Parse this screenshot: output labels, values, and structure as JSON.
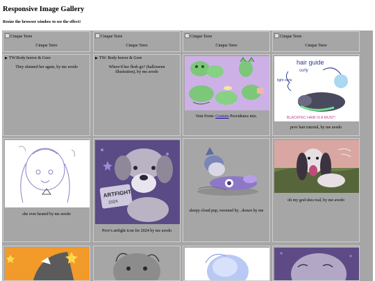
{
  "page": {
    "title": "Responsive Image Gallery",
    "subtitle": "Resize the browser window to see the effect!"
  },
  "gallery": {
    "row1": [
      {
        "alt": "Cinque Terre",
        "caption": "Cinque Terre"
      },
      {
        "alt": "Cinque Terre",
        "caption": "Cinque Terre"
      },
      {
        "alt": "Cinque Terre",
        "caption": "Cinque Terre"
      },
      {
        "alt": "Cinque Terre",
        "caption": "Cinque Terre"
      }
    ],
    "row2": [
      {
        "summary": "TW:Body horror & Gore",
        "caption": "They skinned her again, by me avedo"
      },
      {
        "summary": "TW: Body horror & Gore",
        "caption": "Where'd her flesh go? (halloween illustration), by me avedo"
      },
      {
        "caption_before": "Vent Form: ",
        "link": "Couture",
        "caption_after": " Providence mix."
      },
      {
        "caption": "prov hair tutorial, by me avedo",
        "art_text": [
          "hair guide",
          "curly",
          "tight curls",
          "BLACKPEC HAIR IS A MUST!"
        ]
      }
    ],
    "row3": [
      {
        "caption": "she over heated by me avedo"
      },
      {
        "caption": "Prov's artfight icon for 2024 by me avedo",
        "art_text": [
          "ARTFIGHT",
          "2024"
        ]
      },
      {
        "caption": "sleepy cloud pup, tweened by , drawn by me"
      },
      {
        "caption": "oh my god shes real, by me avedo"
      }
    ]
  },
  "colors": {
    "tile_bg": "#a6a6a6",
    "link": "#1a0dab"
  }
}
